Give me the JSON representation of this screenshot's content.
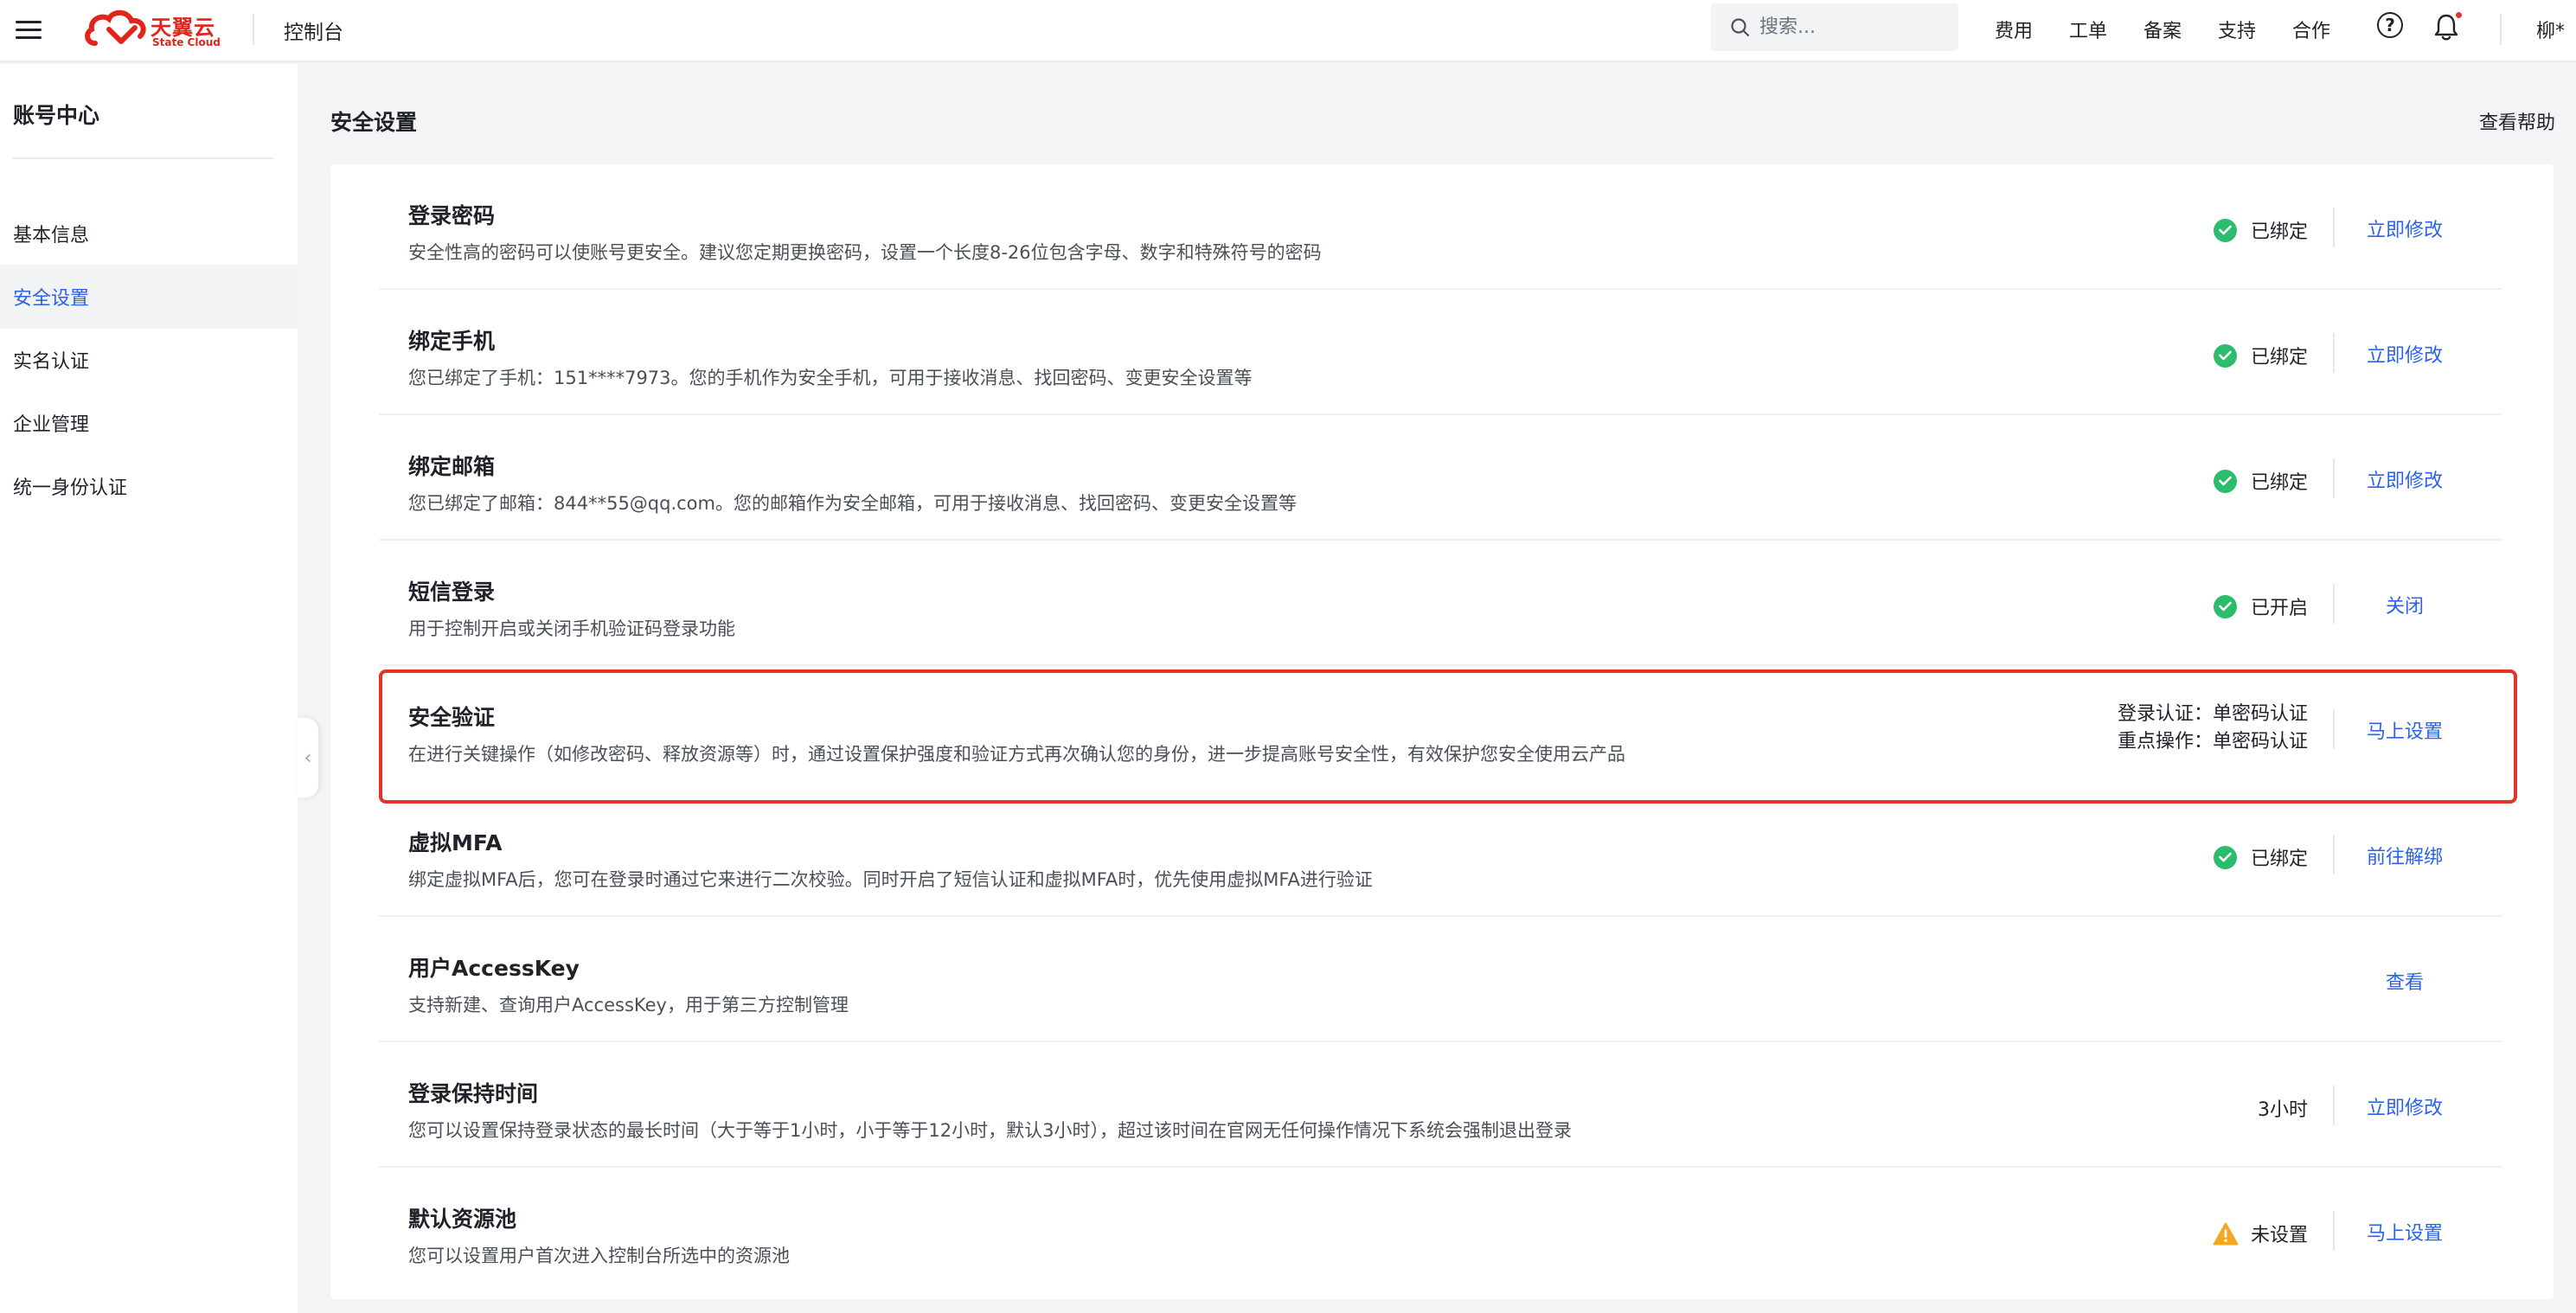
{
  "header": {
    "logo": {
      "name_cn": "天翼云",
      "name_en": "State Cloud",
      "color": "#e1251b"
    },
    "console_title": "控制台",
    "search": {
      "placeholder": "搜索..."
    },
    "nav": [
      "费用",
      "工单",
      "备案",
      "支持",
      "合作"
    ],
    "user": "柳*",
    "icons": [
      "menu-icon",
      "search-icon",
      "help-icon",
      "bell-icon"
    ]
  },
  "sidebar": {
    "title": "账号中心",
    "items": [
      {
        "label": "基本信息",
        "active": false
      },
      {
        "label": "安全设置",
        "active": true
      },
      {
        "label": "实名认证",
        "active": false
      },
      {
        "label": "企业管理",
        "active": false
      },
      {
        "label": "统一身份认证",
        "active": false
      }
    ],
    "collapse_icon": "chevron-left-icon"
  },
  "main": {
    "title": "安全设置",
    "help_link": "查看帮助",
    "rows": [
      {
        "title": "登录密码",
        "desc": "安全性高的密码可以使账号更安全。建议您定期更换密码，设置一个长度8-26位包含字母、数字和特殊符号的密码",
        "status": "已绑定",
        "status_type": "ok",
        "action": "立即修改"
      },
      {
        "title": "绑定手机",
        "desc": "您已绑定了手机：151****7973。您的手机作为安全手机，可用于接收消息、找回密码、变更安全设置等",
        "status": "已绑定",
        "status_type": "ok",
        "action": "立即修改"
      },
      {
        "title": "绑定邮箱",
        "desc": "您已绑定了邮箱：844**55@qq.com。您的邮箱作为安全邮箱，可用于接收消息、找回密码、变更安全设置等",
        "status": "已绑定",
        "status_type": "ok",
        "action": "立即修改"
      },
      {
        "title": "短信登录",
        "desc": "用于控制开启或关闭手机验证码登录功能",
        "status": "已开启",
        "status_type": "ok",
        "action": "关闭"
      },
      {
        "title": "安全验证",
        "desc": "在进行关键操作（如修改密码、释放资源等）时，通过设置保护强度和验证方式再次确认您的身份，进一步提高账号安全性，有效保护您安全使用云产品",
        "info_line1": "登录认证：单密码认证",
        "info_line2": "重点操作：单密码认证",
        "action": "马上设置",
        "highlighted": true
      },
      {
        "title": "虚拟MFA",
        "desc": "绑定虚拟MFA后，您可在登录时通过它来进行二次校验。同时开启了短信认证和虚拟MFA时，优先使用虚拟MFA进行验证",
        "status": "已绑定",
        "status_type": "ok",
        "action": "前往解绑"
      },
      {
        "title": "用户AccessKey",
        "desc": "支持新建、查询用户AccessKey，用于第三方控制管理",
        "action": "查看"
      },
      {
        "title": "登录保持时间",
        "desc": "您可以设置保持登录状态的最长时间（大于等于1小时，小于等于12小时，默认3小时），超过该时间在官网无任何操作情况下系统会强制退出登录",
        "status": "3小时",
        "status_type": "text",
        "action": "立即修改"
      },
      {
        "title": "默认资源池",
        "desc": "您可以设置用户首次进入控制台所选中的资源池",
        "status": "未设置",
        "status_type": "warn",
        "action": "马上设置"
      }
    ]
  },
  "colors": {
    "accent": "#2b62e8",
    "ok": "#2bbc6c",
    "warn": "#f5a623",
    "highlight_border": "#e4342a"
  }
}
